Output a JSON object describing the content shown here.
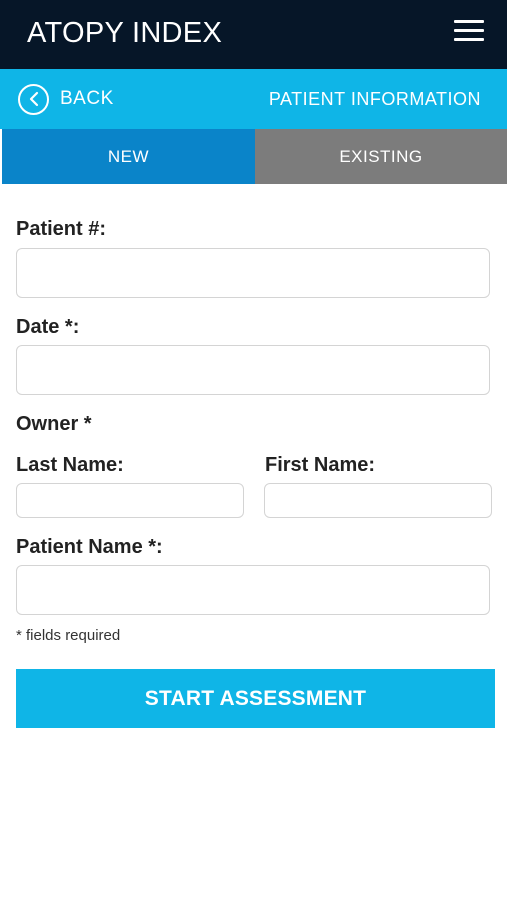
{
  "header": {
    "app_title": "ATOPY INDEX",
    "menu_icon": "hamburger-menu-icon"
  },
  "subheader": {
    "back_label": "BACK",
    "back_icon": "chevron-left-circle-icon",
    "section_title": "PATIENT INFORMATION"
  },
  "tabs": [
    {
      "label": "NEW",
      "active": true
    },
    {
      "label": "EXISTING",
      "active": false
    }
  ],
  "form": {
    "patient_number_label": "Patient #:",
    "patient_number_value": "",
    "date_label": "Date *:",
    "date_value": "",
    "owner_label": "Owner *",
    "last_name_label": "Last Name:",
    "last_name_value": "",
    "first_name_label": "First Name:",
    "first_name_value": "",
    "patient_name_label": "Patient Name *:",
    "patient_name_value": "",
    "required_note": "* fields required",
    "start_button_label": "START ASSESSMENT"
  },
  "colors": {
    "topbar": "#061628",
    "accent": "#0fb5e7",
    "tab_active": "#0a84c9",
    "tab_inactive": "#7c7c7c"
  }
}
